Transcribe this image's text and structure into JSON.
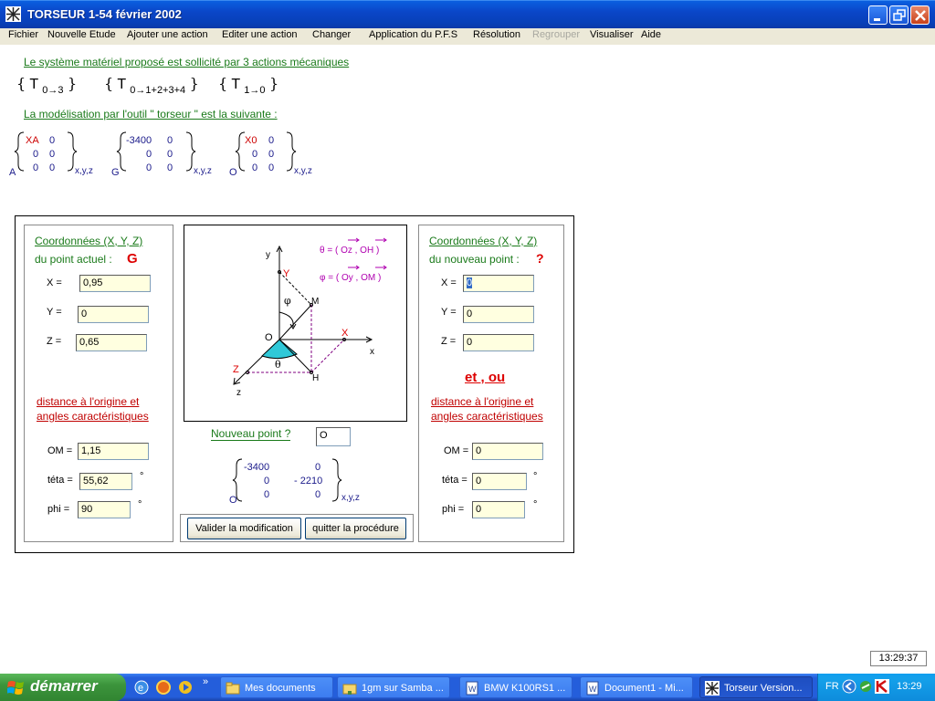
{
  "window": {
    "title": "TORSEUR 1-54  février 2002"
  },
  "menu": [
    "Fichier",
    "Nouvelle Etude",
    "Ajouter une action",
    "Editer une action",
    "Changer",
    "Application du P.F.S",
    "Résolution",
    "Regrouper",
    "Visualiser",
    "Aide"
  ],
  "intro": {
    "line1": "Le système matériel proposé est sollicité par 3 actions mécaniques",
    "actions": [
      {
        "T": "T",
        "sub": "0→3"
      },
      {
        "T": "T",
        "sub": "0→1+2+3+4"
      },
      {
        "T": "T",
        "sub": "1→0"
      }
    ],
    "line2": "La modélisation par l'outil \" torseur \" est la suivante :"
  },
  "torseurs": [
    {
      "point": "A",
      "rows": [
        [
          "XA",
          "0"
        ],
        [
          "0",
          "0"
        ],
        [
          "0",
          "0"
        ]
      ],
      "basis": "x,y,z"
    },
    {
      "point": "G",
      "rows": [
        [
          "-3400",
          "0"
        ],
        [
          "0",
          "0"
        ],
        [
          "0",
          "0"
        ]
      ],
      "basis": "x,y,z"
    },
    {
      "point": "O",
      "rows": [
        [
          "X0",
          "0"
        ],
        [
          "0",
          "0"
        ],
        [
          "0",
          "0"
        ]
      ],
      "basis": "x,y,z"
    }
  ],
  "left_panel": {
    "title": "Coordonnées (X, Y, Z)",
    "subtitle": "du point actuel :",
    "point": "G",
    "x_label": "X =",
    "x_value": "0,95",
    "y_label": "Y =",
    "y_value": "0",
    "z_label": "Z =",
    "z_value": "0,65",
    "dist_title1": "distance à l'origine et",
    "dist_title2": "angles caractéristiques",
    "om_label": "OM =",
    "om_value": "1,15",
    "theta_label": "téta =",
    "theta_value": "55,62",
    "phi_label": "phi =",
    "phi_value": "90",
    "deg": "°"
  },
  "diagram": {
    "theta_def": "θ  = ( Oz , OH )",
    "phi_def": "φ  = ( Oy , OM )",
    "labels": {
      "y": "y",
      "x": "x",
      "z": "z",
      "O": "O",
      "M": "M",
      "H": "H",
      "X": "X",
      "Y": "Y",
      "Z": "Z",
      "theta": "θ",
      "phi": "φ"
    }
  },
  "center": {
    "new_point_label": "Nouveau point ?",
    "new_point_value": "O",
    "result": {
      "point": "O",
      "rows": [
        [
          "-3400",
          "0"
        ],
        [
          "0",
          "- 2210"
        ],
        [
          "0",
          "0"
        ]
      ],
      "basis": "x,y,z"
    },
    "validate_btn": "Valider la modification",
    "quit_btn": "quitter la procédure"
  },
  "right_panel": {
    "title": "Coordonnées (X, Y, Z)",
    "subtitle": "du nouveau point :",
    "point": "?",
    "x_label": "X =",
    "x_value": "0",
    "y_label": "Y =",
    "y_value": "0",
    "z_label": "Z =",
    "z_value": "0",
    "et_ou": "et , ou",
    "dist_title1": "distance à l'origine et",
    "dist_title2": "angles caractéristiques",
    "om_label": "OM =",
    "om_value": "0",
    "theta_label": "téta =",
    "theta_value": "0",
    "phi_label": "phi =",
    "phi_value": "0",
    "deg": "°"
  },
  "status_time": "13:29:37",
  "taskbar": {
    "start": "démarrer",
    "tasks": [
      "Mes documents",
      "1gm sur Samba ...",
      "BMW K100RS1 ...",
      "Document1 - Mi...",
      "Torseur Version..."
    ],
    "lang": "FR",
    "clock": "13:29"
  }
}
